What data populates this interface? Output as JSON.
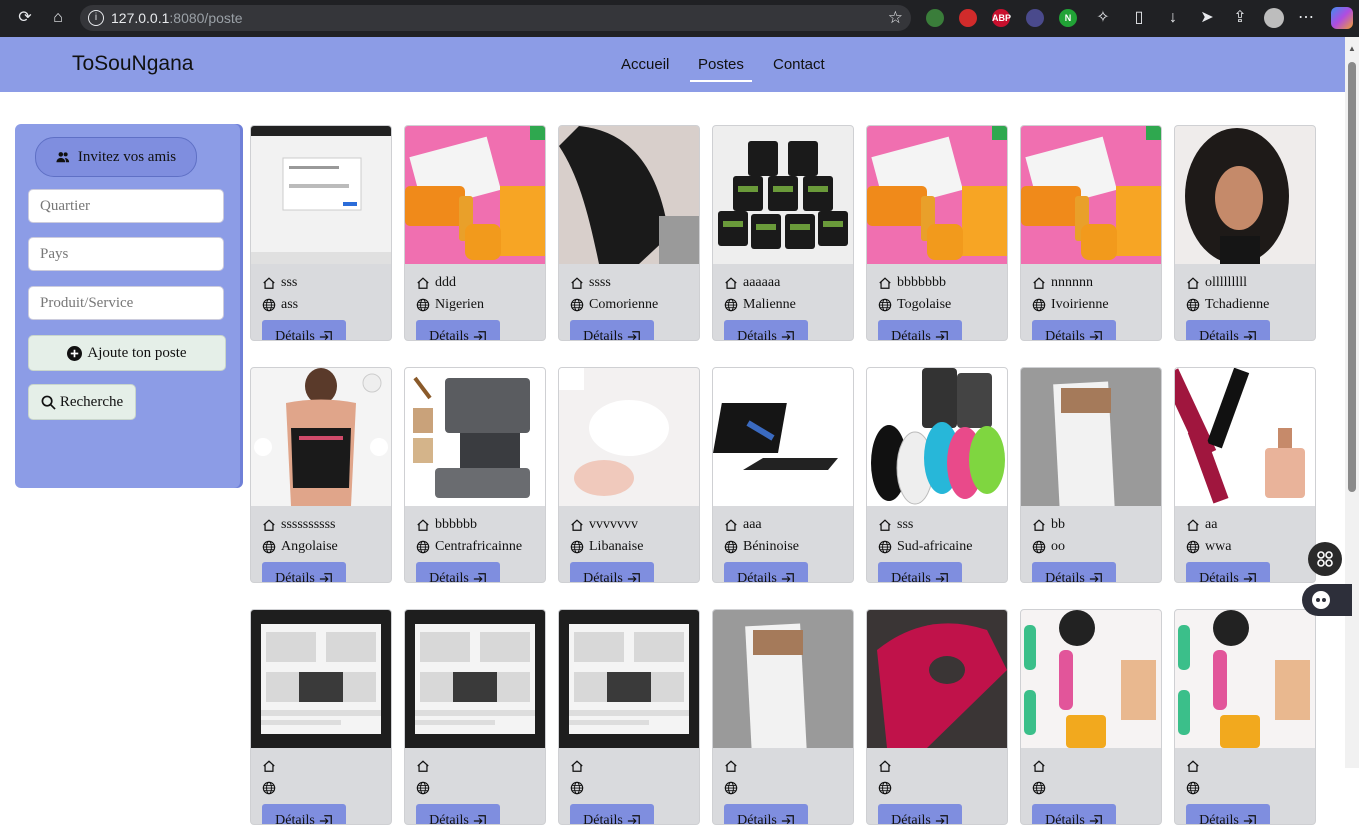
{
  "browser": {
    "url_host": "127.0.0.1",
    "url_rest": ":8080/poste",
    "ext_labels": [
      "ABP",
      "N"
    ]
  },
  "navbar": {
    "brand": "ToSouNgana",
    "links": [
      {
        "label": "Accueil"
      },
      {
        "label": "Postes",
        "active": true
      },
      {
        "label": "Contact"
      }
    ]
  },
  "sidebar": {
    "invite_label": "Invitez vos amis",
    "fields": [
      {
        "placeholder": "Quartier"
      },
      {
        "placeholder": "Pays"
      },
      {
        "placeholder": "Produit/Service"
      }
    ],
    "add_label": "Ajoute ton poste",
    "search_label": "Recherche"
  },
  "details_label": "Détails",
  "posts": [
    {
      "name": "sss",
      "country": "ass",
      "image": "screenshot-browser"
    },
    {
      "name": "ddd",
      "country": "Nigerien",
      "image": "vitamin-c-kit"
    },
    {
      "name": "ssss",
      "country": "Comorienne",
      "image": "hair-wig"
    },
    {
      "name": "aaaaaa",
      "country": "Malienne",
      "image": "black-jars"
    },
    {
      "name": "bbbbbbb",
      "country": "Togolaise",
      "image": "vitamin-c-kit"
    },
    {
      "name": "nnnnnn",
      "country": "Ivoirienne",
      "image": "vitamin-c-kit"
    },
    {
      "name": "olllllllll",
      "country": "Tchadienne",
      "image": "curly-wig"
    },
    {
      "name": "ssssssssss",
      "country": "Angolaise",
      "image": "posture-brace"
    },
    {
      "name": "bbbbbb",
      "country": "Centrafricainne",
      "image": "machine"
    },
    {
      "name": "vvvvvvv",
      "country": "Libanaise",
      "image": "teeth-whitening"
    },
    {
      "name": "aaa",
      "country": "Béninoise",
      "image": "tablet-keyboard"
    },
    {
      "name": "sss",
      "country": "Sud-africaine",
      "image": "tracker-tags"
    },
    {
      "name": "bb",
      "country": "oo",
      "image": "package"
    },
    {
      "name": "aa",
      "country": "wwa",
      "image": "perfume-bottles"
    },
    {
      "name": "",
      "country": "",
      "image": "screenshot-shop"
    },
    {
      "name": "",
      "country": "",
      "image": "screenshot-shop"
    },
    {
      "name": "",
      "country": "",
      "image": "screenshot-shop"
    },
    {
      "name": "",
      "country": "",
      "image": "package"
    },
    {
      "name": "",
      "country": "",
      "image": "red-tool"
    },
    {
      "name": "",
      "country": "",
      "image": "perfume-spray"
    },
    {
      "name": "",
      "country": "",
      "image": "perfume-spray"
    }
  ],
  "colors": {
    "accent": "#8c9ce6",
    "button": "#7f8edf",
    "card": "#d9dadd"
  }
}
